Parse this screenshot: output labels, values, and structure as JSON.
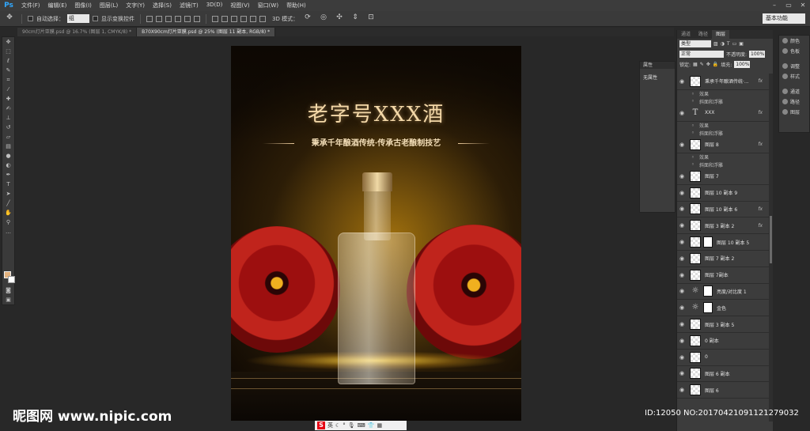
{
  "app": {
    "logo": "Ps"
  },
  "menu": [
    "文件(F)",
    "编辑(E)",
    "图像(I)",
    "图层(L)",
    "文字(Y)",
    "选择(S)",
    "滤镜(T)",
    "3D(D)",
    "视图(V)",
    "窗口(W)",
    "帮助(H)"
  ],
  "options": {
    "auto_select_label": "自动选择：",
    "auto_select_value": "组",
    "show_transform_label": "显示变换控件",
    "mode_3d_label": "3D 模式：",
    "workspace": "基本功能"
  },
  "tabs": [
    {
      "label": "90cm灯片亚膜.psd @ 16.7% (图层 1, CMYK/8) *",
      "active": false
    },
    {
      "label": "B70X90cm灯片亚膜.psd @ 25% (图层 11 副本, RGB/8) *",
      "active": true
    }
  ],
  "canvas": {
    "title": "老字号XXX酒",
    "slogan": "秉承千年酿酒传统·传承古老酿制技艺"
  },
  "properties": {
    "title": "属性",
    "body": "无属性"
  },
  "layers_panel": {
    "tabs": [
      "通道",
      "路径",
      "图层"
    ],
    "active_tab": "图层",
    "filter_label": "类型",
    "blend_mode": "正常",
    "opacity_label": "不透明度:",
    "opacity_value": "100%",
    "lock_label": "锁定:",
    "fill_label": "填充:",
    "fill_value": "100%",
    "layers": [
      {
        "name": "秉承千年酿酒传统·...",
        "kind": "layer",
        "fx": "fx"
      },
      {
        "name": "效果",
        "kind": "sub"
      },
      {
        "name": "斜面和浮雕",
        "kind": "sub"
      },
      {
        "name": "XXX",
        "kind": "type",
        "fx": "fx"
      },
      {
        "name": "效果",
        "kind": "sub"
      },
      {
        "name": "斜面和浮雕",
        "kind": "sub"
      },
      {
        "name": "图层 8",
        "kind": "layer",
        "fx": "fx"
      },
      {
        "name": "效果",
        "kind": "sub"
      },
      {
        "name": "斜面和浮雕",
        "kind": "sub"
      },
      {
        "name": "图层 7",
        "kind": "layer"
      },
      {
        "name": "图层 10 副本 9",
        "kind": "layer"
      },
      {
        "name": "图层 10 副本 6",
        "kind": "layer",
        "fx": "fx"
      },
      {
        "name": "图层 3 副本 2",
        "kind": "layer",
        "fx": "fx"
      },
      {
        "name": "图层 10 副本 5",
        "kind": "masked"
      },
      {
        "name": "图层 7 副本 2",
        "kind": "layer"
      },
      {
        "name": "图层 7副本",
        "kind": "layer"
      },
      {
        "name": "亮度/对比度 1",
        "kind": "adjust"
      },
      {
        "name": "金色",
        "kind": "adjust"
      },
      {
        "name": "图层 3 副本 5",
        "kind": "layer"
      },
      {
        "name": "0 副本",
        "kind": "layer"
      },
      {
        "name": "0",
        "kind": "layer"
      },
      {
        "name": "图层 6 副本",
        "kind": "layer"
      },
      {
        "name": "图层 6",
        "kind": "layer"
      }
    ]
  },
  "dock": [
    "颜色",
    "色板",
    "调整",
    "样式",
    "通道",
    "路径",
    "图层"
  ],
  "watermark": "昵图网 www.nipic.com",
  "stamp_id": "ID:12050 NO:20170421091121279032",
  "ime": {
    "lang": "英"
  }
}
